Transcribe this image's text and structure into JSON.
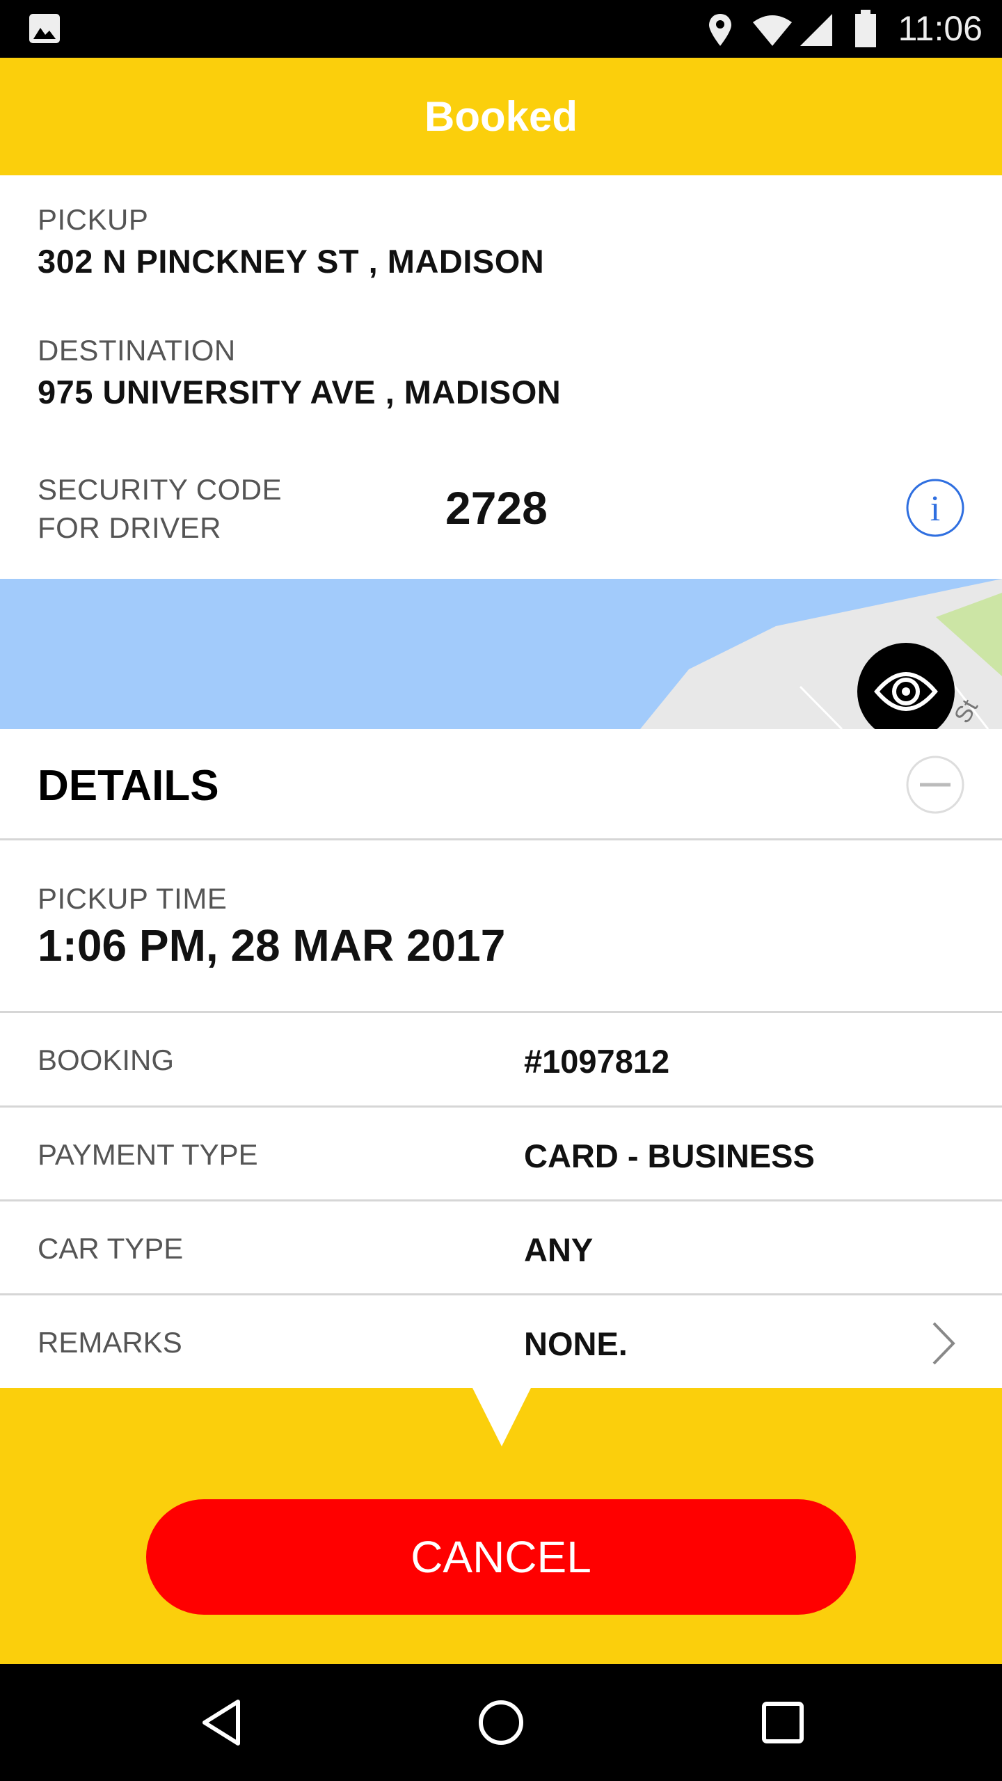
{
  "status_bar": {
    "time": "11:06",
    "icons": [
      "image-icon",
      "location-icon",
      "wifi-icon",
      "signal-icon",
      "battery-icon"
    ]
  },
  "header": {
    "title": "Booked"
  },
  "trip": {
    "pickup_label": "PICKUP",
    "pickup_value": "302 N PINCKNEY ST , MADISON",
    "destination_label": "DESTINATION",
    "destination_value": "975 UNIVERSITY AVE , MADISON",
    "security_label_1": "SECURITY CODE",
    "security_label_2": "FOR DRIVER",
    "security_code": "2728"
  },
  "map": {
    "street_label": "St"
  },
  "details": {
    "title": "DETAILS",
    "pickup_time_label": "PICKUP TIME",
    "pickup_time_value": "1:06 PM, 28 MAR 2017",
    "rows": [
      {
        "label": "BOOKING",
        "value": "#1097812"
      },
      {
        "label": "PAYMENT TYPE",
        "value": "CARD - BUSINESS"
      },
      {
        "label": "CAR TYPE",
        "value": "ANY"
      },
      {
        "label": "REMARKS",
        "value": "NONE."
      }
    ]
  },
  "actions": {
    "cancel_label": "CANCEL"
  },
  "colors": {
    "accent": "#FBCF0C",
    "cancel": "#FF0000",
    "info": "#2F6FE0"
  }
}
